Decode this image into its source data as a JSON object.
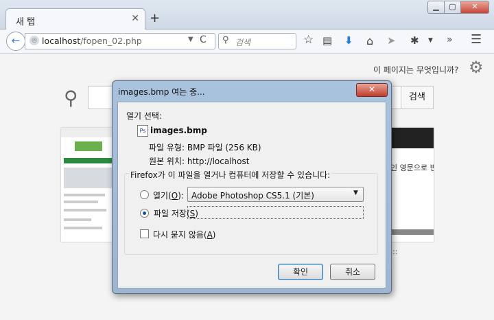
{
  "browser": {
    "tab_title": "새 탭",
    "tab_close": "✕",
    "new_tab": "+",
    "window_buttons": {
      "min": "▁",
      "max": "▢",
      "close": "✕"
    },
    "nav": {
      "back": "←",
      "url_host": "localhost",
      "url_path": "/fopen_02.php",
      "url_dropdown": "▼",
      "reload": "C",
      "search_placeholder": "검색"
    },
    "toolbar_icons": [
      "star-icon",
      "reading-list-icon",
      "download-icon",
      "home-icon",
      "send-icon",
      "extension-icon",
      "overflow-icon",
      "menu-icon"
    ]
  },
  "page": {
    "what_is_this": "이 페이지는 무엇입니까?",
    "search_button": "검색",
    "thumb_right_text": "인 영문으로 변경",
    "thumb_dots": "::"
  },
  "dialog": {
    "title": "images.bmp 여는 중...",
    "close": "✕",
    "open_with_heading": "열기 선택:",
    "file_icon": "Ps",
    "file_name": "images.bmp",
    "file_type": "파일 유형: BMP 파일 (256 KB)",
    "source": "원본 위치: http://localhost",
    "question": "Firefox가 이 파일을 열거나 컴퓨터에 저장할 수 있습니다:",
    "open_label": "열기(",
    "open_key": "O",
    "open_label_end": "):",
    "app_selected": "Adobe Photoshop CS5.1 (기본)",
    "save_label": "파일 저장(",
    "save_key": "S",
    "save_label_end": ")",
    "dont_ask_label": "다시 묻지 않음(",
    "dont_ask_key": "A",
    "dont_ask_end": ")",
    "ok": "확인",
    "cancel": "취소",
    "selected_option": "save",
    "dont_ask_checked": false
  },
  "colors": {
    "accent": "#3a7bd5",
    "close_red": "#c9463a",
    "dialog_frame": "#a9c2de"
  }
}
